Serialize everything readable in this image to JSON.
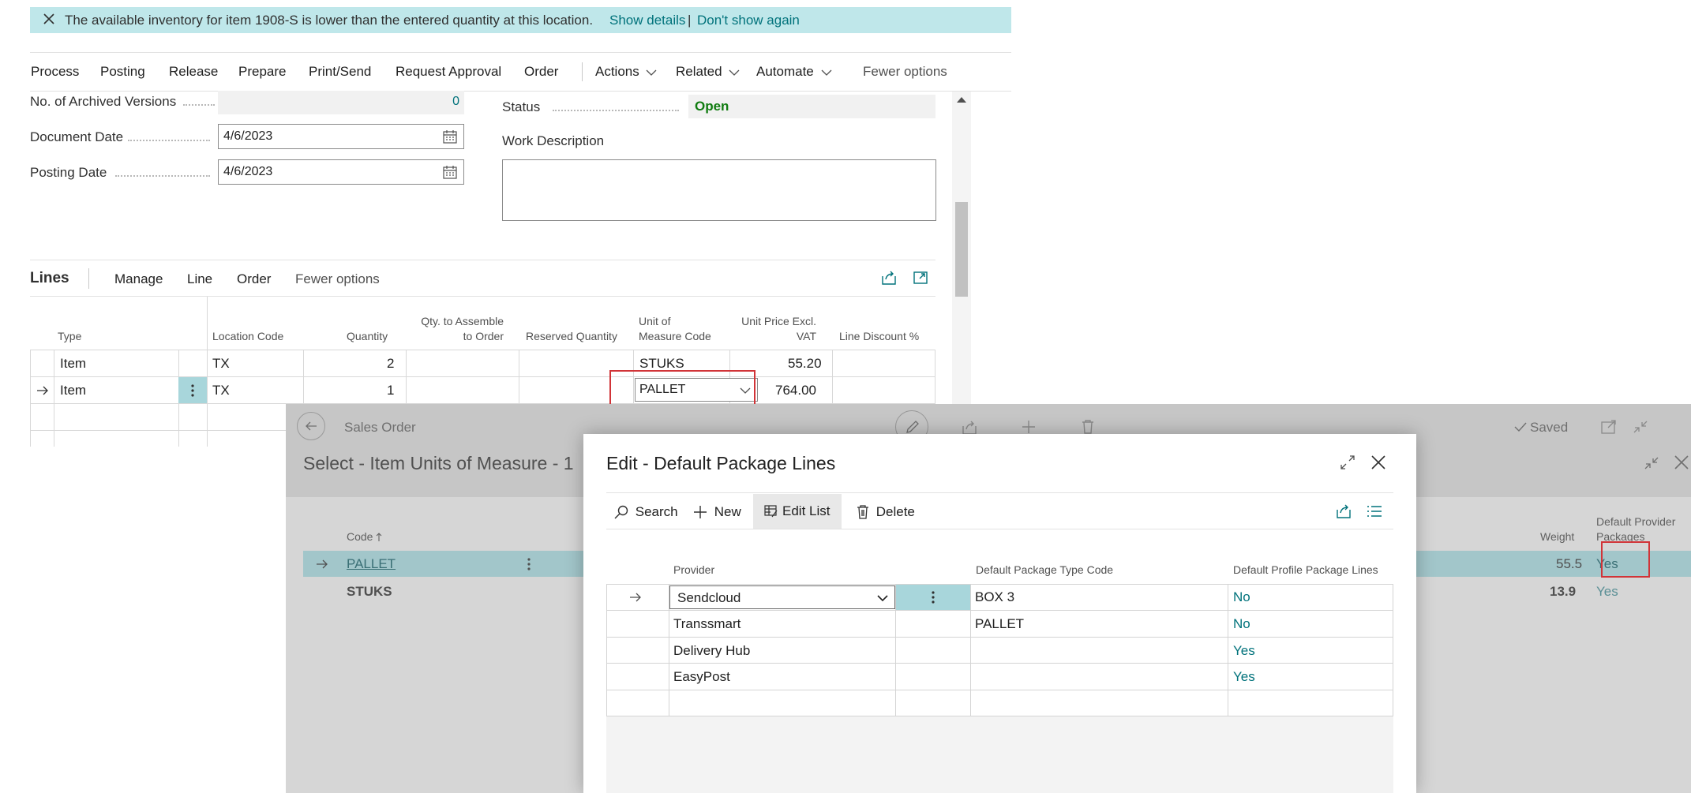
{
  "notification": {
    "message": "The available inventory for item 1908-S is lower than the entered quantity at this location.",
    "show_details": "Show details",
    "separator": "|",
    "dont_show": "Don't show again"
  },
  "actionbar": {
    "items": [
      "Process",
      "Posting",
      "Release",
      "Prepare",
      "Print/Send",
      "Request Approval",
      "Order",
      "Actions",
      "Related",
      "Automate",
      "Fewer options"
    ]
  },
  "header": {
    "archived_label": "No. of Archived Versions",
    "archived_value": "0",
    "document_date_label": "Document Date",
    "document_date_value": "4/6/2023",
    "posting_date_label": "Posting Date",
    "posting_date_value": "4/6/2023",
    "status_label": "Status",
    "status_value": "Open",
    "work_description_label": "Work Description"
  },
  "lines": {
    "title": "Lines",
    "menu": [
      "Manage",
      "Line",
      "Order",
      "Fewer options"
    ],
    "columns": {
      "type": "Type",
      "location": "Location Code",
      "quantity": "Quantity",
      "qty_assemble_1": "Qty. to Assemble",
      "qty_assemble_2": "to Order",
      "reserved": "Reserved Quantity",
      "uom_1": "Unit of",
      "uom_2": "Measure Code",
      "price_1": "Unit Price Excl.",
      "price_2": "VAT",
      "discount": "Line Discount %"
    },
    "rows": [
      {
        "type": "Item",
        "location": "TX",
        "quantity": "2",
        "uom": "STUKS",
        "price": "55.20"
      },
      {
        "type": "Item",
        "location": "TX",
        "quantity": "1",
        "uom": "PALLET",
        "price": "764.00"
      }
    ]
  },
  "background_page": {
    "sales_order_label": "Sales Order",
    "saved_label": "Saved",
    "select_title": "Select - Item Units of Measure - 1",
    "code_header": "Code",
    "weight_header": "Weight",
    "default_provider_header_1": "Default Provider",
    "default_provider_header_2": "Packages",
    "rows": [
      {
        "code": "PALLET",
        "weight": "55.5",
        "default": "Yes"
      },
      {
        "code": "STUKS",
        "weight": "13.9",
        "default": "Yes"
      }
    ]
  },
  "dialog": {
    "title": "Edit - Default Package Lines",
    "toolbar": {
      "search": "Search",
      "new": "New",
      "edit_list": "Edit List",
      "delete": "Delete"
    },
    "columns": {
      "provider": "Provider",
      "package_type": "Default Package Type Code",
      "profile_lines": "Default Profile Package Lines"
    },
    "rows": [
      {
        "provider": "Sendcloud",
        "package_type": "BOX 3",
        "profile": "No"
      },
      {
        "provider": "Transsmart",
        "package_type": "PALLET",
        "profile": "No"
      },
      {
        "provider": "Delivery Hub",
        "package_type": "",
        "profile": "Yes"
      },
      {
        "provider": "EasyPost",
        "package_type": "",
        "profile": "Yes"
      }
    ]
  },
  "colors": {
    "notification_bg": "#bfe7ea",
    "accent_teal": "#00727b",
    "status_green": "#107c10",
    "highlight_red": "#d13438",
    "selected_row": "#a8d6db"
  }
}
